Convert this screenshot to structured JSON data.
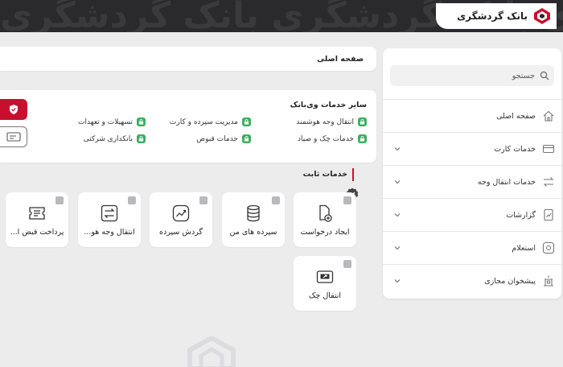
{
  "header": {
    "pattern_text": "بانک گردشگری بانک گردشگری بانک گردشگری",
    "brand_name": "بانک گردشگری"
  },
  "sidebar": {
    "search_placeholder": "جستجو",
    "items": [
      {
        "label": "صفحه اصلی",
        "icon": "home-icon",
        "has_chevron": false
      },
      {
        "label": "خدمات کارت",
        "icon": "card-icon",
        "has_chevron": true
      },
      {
        "label": "خدمات انتقال وجه",
        "icon": "transfer-icon",
        "has_chevron": true
      },
      {
        "label": "گزارشات",
        "icon": "report-icon",
        "has_chevron": true
      },
      {
        "label": "استعلام",
        "icon": "inquiry-icon",
        "has_chevron": true
      },
      {
        "label": "پیشخوان مجازی",
        "icon": "counter-icon",
        "has_chevron": true
      }
    ]
  },
  "breadcrumb": {
    "label": "صفحه اصلی"
  },
  "services": {
    "title": "سایر خدمات وی‌بانک",
    "items": [
      "انتقال وجه هوشمند",
      "مدیریت سپرده و کارت",
      "تسهیلات و تعهدات",
      "خدمات چک و صیاد",
      "خدمات قبوض",
      "بانکداری شرکتی"
    ]
  },
  "fixed": {
    "title": "خدمات ثابت",
    "tiles": [
      {
        "label": "ایجاد درخواست",
        "icon": "new-request-icon"
      },
      {
        "label": "سپرده های من",
        "icon": "deposits-icon"
      },
      {
        "label": "گردش سپرده",
        "icon": "turnover-icon"
      },
      {
        "label": "انتقال وجه هو...",
        "icon": "transfer-arrows-icon"
      },
      {
        "label": "پرداخت قبض ا...",
        "icon": "bill-icon"
      },
      {
        "label": "انتقال چک",
        "icon": "check-transfer-icon"
      }
    ]
  },
  "colors": {
    "accent": "#c8102e",
    "lock_green": "#3cae5c",
    "header_bg": "#2a2a2c"
  }
}
